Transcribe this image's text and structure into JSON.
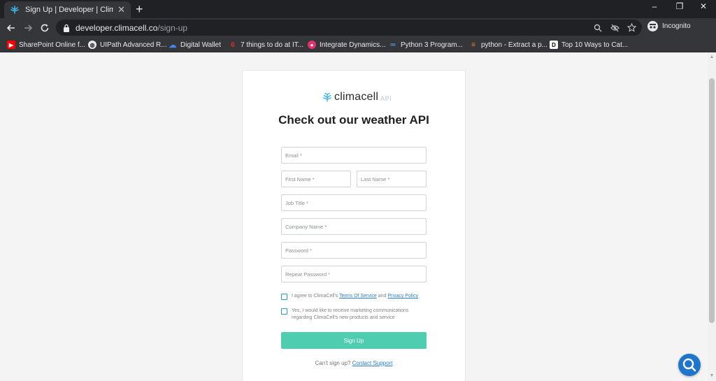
{
  "browser": {
    "tab_title": "Sign Up | Developer | ClimaCell",
    "tab_close": "✕",
    "new_tab": "+",
    "url_host": "developer.climacell.co",
    "url_path": "/sign-up",
    "profile_label": "Incognito",
    "window_controls": {
      "minimize": "–",
      "restore": "❐",
      "close": "✕"
    }
  },
  "bookmarks": [
    {
      "label": "SharePoint Online f...",
      "icon": "youtube-icon",
      "color": "#ff0000"
    },
    {
      "label": "UIPath Advanced R...",
      "icon": "globe-icon",
      "color": "#e8eaed"
    },
    {
      "label": "Digital Wallet",
      "icon": "cloud-icon",
      "color": "#4285f4"
    },
    {
      "label": "7 things to do at IT...",
      "icon": "bookmark-g-icon",
      "color": "#d93025"
    },
    {
      "label": "Integrate Dynamics...",
      "icon": "record-icon",
      "color": "#e8306b"
    },
    {
      "label": "Python 3 Program...",
      "icon": "infinity-icon",
      "color": "#4a90e2"
    },
    {
      "label": "python - Extract a p...",
      "icon": "stackoverflow-icon",
      "color": "#f48024"
    },
    {
      "label": "Top 10 Ways to Cat...",
      "icon": "d-icon",
      "color": "#ffffff"
    }
  ],
  "card": {
    "brand": "climacell",
    "brand_suffix": "API",
    "heading": "Check out our weather API",
    "fields": {
      "email": "Email *",
      "first_name": "First Name *",
      "last_name": "Last Name *",
      "job_title": "Job Title *",
      "company_name": "Company Name *",
      "password": "Password *",
      "repeat_password": "Repeat Password *"
    },
    "terms": {
      "prefix": "I agree to ClimaCell's ",
      "tos": "Terms Of Service",
      "and": " and ",
      "privacy": "Privacy Policy"
    },
    "marketing": "Yes, I would like to receive marketing communications regarding ClimaCell's new products and service",
    "signup_button": "Sign Up",
    "cant_signup": "Can't sign up? ",
    "contact_support": "Contact Support"
  },
  "colors": {
    "accent": "#4fcdb0",
    "link": "#2a7fd4",
    "chat": "#1f75cb"
  }
}
